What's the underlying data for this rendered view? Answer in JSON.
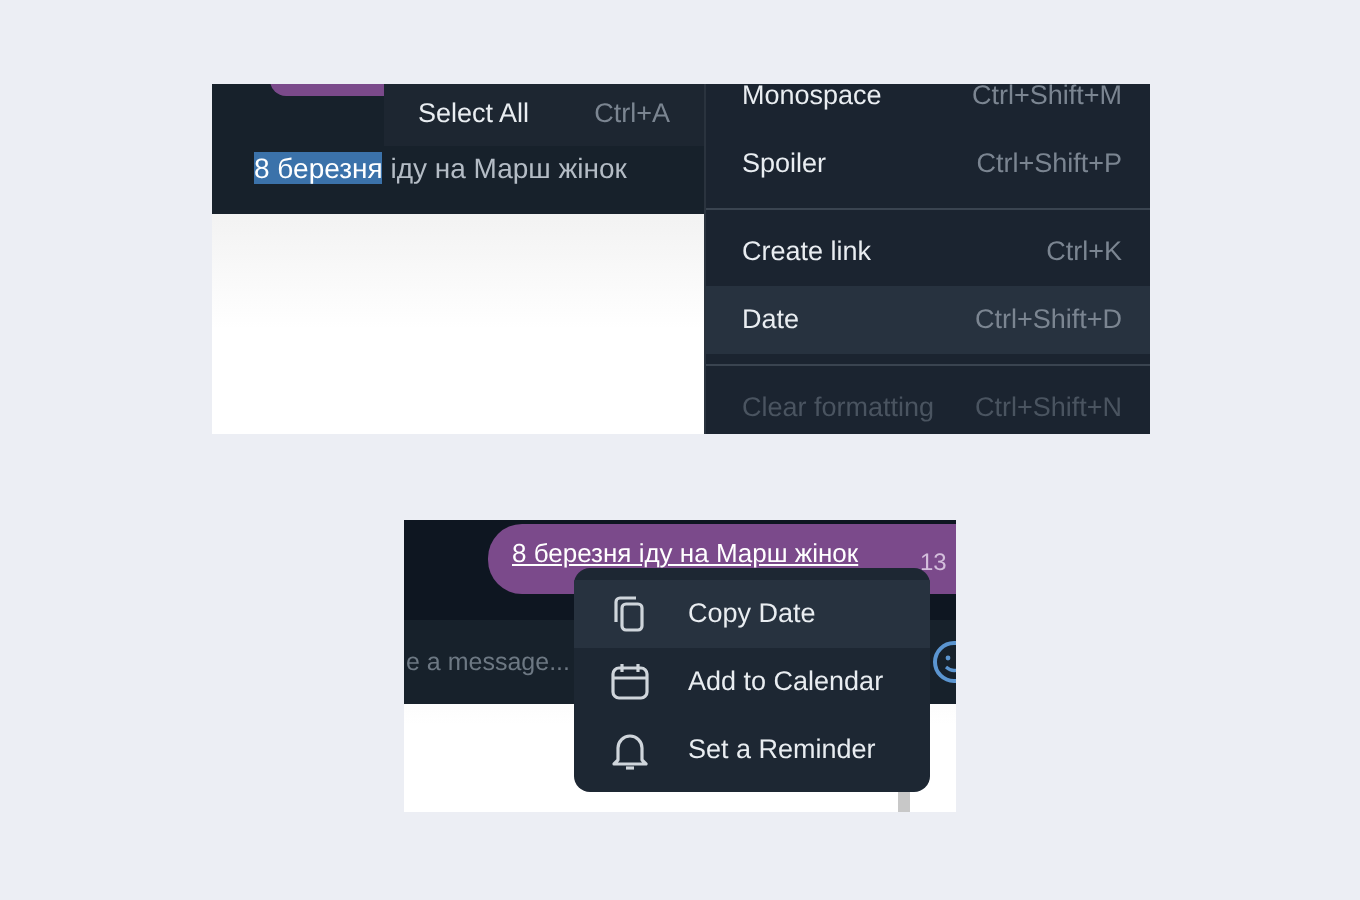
{
  "panel_1": {
    "message_parts": [
      {
        "text": "8 березня",
        "selected": true
      },
      {
        "text": "іду на Марш жінок",
        "selected": false
      }
    ],
    "edit_menu": [
      {
        "label": "Select All",
        "shortcut": "Ctrl+A"
      }
    ],
    "format_menu": [
      {
        "kind": "item",
        "label": "Monospace",
        "shortcut": "Ctrl+Shift+M",
        "selected": false,
        "disabled": false
      },
      {
        "kind": "item",
        "label": "Spoiler",
        "shortcut": "Ctrl+Shift+P",
        "selected": false,
        "disabled": false
      },
      {
        "kind": "divider"
      },
      {
        "kind": "item",
        "label": "Create link",
        "shortcut": "Ctrl+K",
        "selected": false,
        "disabled": false
      },
      {
        "kind": "item",
        "label": "Date",
        "shortcut": "Ctrl+Shift+D",
        "selected": true,
        "disabled": false
      },
      {
        "kind": "divider"
      },
      {
        "kind": "item",
        "label": "Clear formatting",
        "shortcut": "Ctrl+Shift+N",
        "selected": false,
        "disabled": true
      }
    ]
  },
  "panel_2": {
    "message": {
      "text": "8 березня іду на Марш жінок",
      "time": "13"
    },
    "input": {
      "placeholder": "e a message..."
    },
    "date_menu": [
      {
        "kind": "copy",
        "label": "Copy Date",
        "selected": true
      },
      {
        "kind": "calendar",
        "label": "Add to Calendar",
        "selected": false
      },
      {
        "kind": "bell",
        "label": "Set a Reminder",
        "selected": false
      }
    ]
  }
}
